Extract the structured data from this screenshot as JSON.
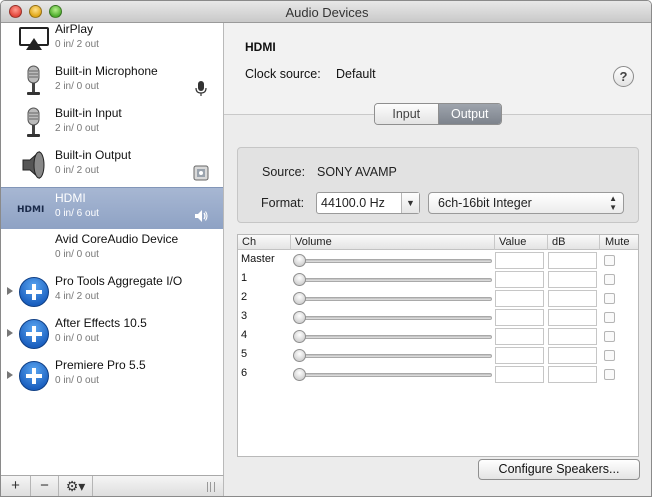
{
  "window": {
    "title": "Audio Devices"
  },
  "sidebar": {
    "devices": [
      {
        "name": "AirPlay",
        "io": "0 in/ 2 out",
        "icon": "airplay-icon"
      },
      {
        "name": "Built-in Microphone",
        "io": "2 in/ 0 out",
        "icon": "microphone-icon",
        "badge": "microphone-input-badge"
      },
      {
        "name": "Built-in Input",
        "io": "2 in/ 0 out",
        "icon": "microphone-icon"
      },
      {
        "name": "Built-in Output",
        "io": "0 in/ 2 out",
        "icon": "speaker-icon",
        "badge": "finder-alert-badge"
      },
      {
        "name": "HDMI",
        "io": "0 in/ 6 out",
        "icon": "hdmi-icon",
        "badge": "speaker-output-badge",
        "selected": true
      },
      {
        "name": "Avid CoreAudio Device",
        "io": "0 in/ 0 out"
      },
      {
        "name": "Pro Tools Aggregate I/O",
        "io": "4 in/ 2 out",
        "icon": "aggregate-device-icon",
        "expandable": true
      },
      {
        "name": "After Effects 10.5",
        "io": "0 in/ 0 out",
        "icon": "aggregate-device-icon",
        "expandable": true
      },
      {
        "name": "Premiere Pro 5.5",
        "io": "0 in/ 0 out",
        "icon": "aggregate-device-icon",
        "expandable": true
      }
    ],
    "bottom": {
      "add": "+",
      "remove": "−",
      "gear": "⚙▾"
    }
  },
  "detail": {
    "title": "HDMI",
    "clock_label": "Clock source:",
    "clock_value": "Default",
    "help": "?",
    "tabs": [
      {
        "label": "Input",
        "active": false
      },
      {
        "label": "Output",
        "active": true
      }
    ],
    "source_label": "Source:",
    "source_value": "SONY AVAMP",
    "format_label": "Format:",
    "sample_rate": "44100.0 Hz",
    "bit_format": "6ch-16bit Integer",
    "table": {
      "headers": {
        "ch": "Ch",
        "volume": "Volume",
        "value": "Value",
        "db": "dB",
        "mute": "Mute"
      },
      "rows": [
        "Master",
        "1",
        "2",
        "3",
        "4",
        "5",
        "6"
      ]
    },
    "configure_button": "Configure Speakers..."
  }
}
